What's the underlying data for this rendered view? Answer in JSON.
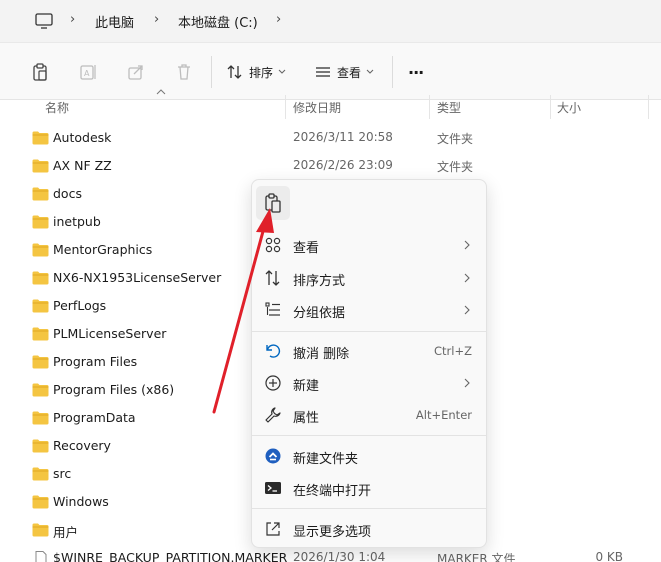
{
  "address": {
    "crumbs": [
      "此电脑",
      "本地磁盘 (C:)"
    ]
  },
  "toolbar": {
    "sort_label": "排序",
    "view_label": "查看",
    "more_label": "···"
  },
  "columns": {
    "name": "名称",
    "modified": "修改日期",
    "type": "类型",
    "size": "大小"
  },
  "files": [
    {
      "name": "Autodesk",
      "date": "2026/3/11 20:58",
      "type": "文件夹",
      "size": ""
    },
    {
      "name": "AX NF ZZ",
      "date": "2026/2/26 23:09",
      "type": "文件夹",
      "size": ""
    },
    {
      "name": "docs",
      "date": "",
      "type": "",
      "size": ""
    },
    {
      "name": "inetpub",
      "date": "",
      "type": "",
      "size": ""
    },
    {
      "name": "MentorGraphics",
      "date": "",
      "type": "",
      "size": ""
    },
    {
      "name": "NX6-NX1953LicenseServer",
      "date": "",
      "type": "",
      "size": ""
    },
    {
      "name": "PerfLogs",
      "date": "",
      "type": "",
      "size": ""
    },
    {
      "name": "PLMLicenseServer",
      "date": "",
      "type": "",
      "size": ""
    },
    {
      "name": "Program Files",
      "date": "",
      "type": "",
      "size": ""
    },
    {
      "name": "Program Files (x86)",
      "date": "",
      "type": "",
      "size": ""
    },
    {
      "name": "ProgramData",
      "date": "",
      "type": "",
      "size": ""
    },
    {
      "name": "Recovery",
      "date": "",
      "type": "",
      "size": ""
    },
    {
      "name": "src",
      "date": "",
      "type": "",
      "size": ""
    },
    {
      "name": "Windows",
      "date": "",
      "type": "",
      "size": ""
    },
    {
      "name": "用户",
      "date": "",
      "type": "",
      "size": ""
    },
    {
      "name": "$WINRE_BACKUP_PARTITION.MARKER",
      "date": "2026/1/30 1:04",
      "type": "MARKER 文件",
      "size": "0 KB"
    }
  ],
  "context_menu": {
    "view": "查看",
    "sort_by": "排序方式",
    "group_by": "分组依据",
    "undo_delete": "撤消 删除",
    "undo_shortcut": "Ctrl+Z",
    "new": "新建",
    "properties": "属性",
    "properties_shortcut": "Alt+Enter",
    "new_folder": "新建文件夹",
    "open_in_terminal": "在终端中打开",
    "show_more": "显示更多选项"
  },
  "colors": {
    "folder": "#f4c542",
    "accent": "#0067c0",
    "annotation_arrow": "#e0202a"
  }
}
